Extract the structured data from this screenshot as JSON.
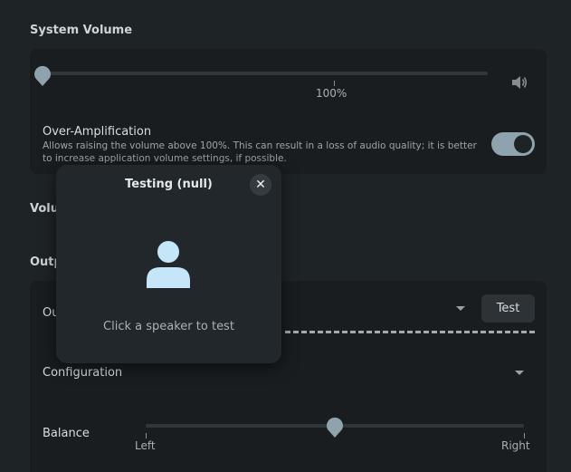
{
  "system_volume": {
    "title": "System Volume",
    "level_label": "100%",
    "volume_fraction": 0.0
  },
  "over_amplification": {
    "title": "Over-Amplification",
    "description": "Allows raising the volume above 100%. This can result in a loss of audio quality; it is better to increase application volume settings, if possible.",
    "enabled": true
  },
  "volume_section": {
    "title_partial": "Volu"
  },
  "output_section": {
    "title_partial": "Outp",
    "device_label_partial": "Ou",
    "test_label": "Test",
    "configuration_label": "Configuration",
    "balance_label": "Balance",
    "balance_left": "Left",
    "balance_right": "Right",
    "balance_fraction": 0.5
  },
  "dialog": {
    "title": "Testing (null)",
    "close_glyph": "✕",
    "hint": "Click a speaker to test"
  },
  "icons": {
    "speaker": "speaker-volume-icon",
    "user": "user-avatar-icon",
    "close": "close-icon",
    "dropdown": "chevron-down-icon"
  },
  "colors": {
    "accent": "#8fa3ae",
    "avatar": "#c4e6f8"
  }
}
